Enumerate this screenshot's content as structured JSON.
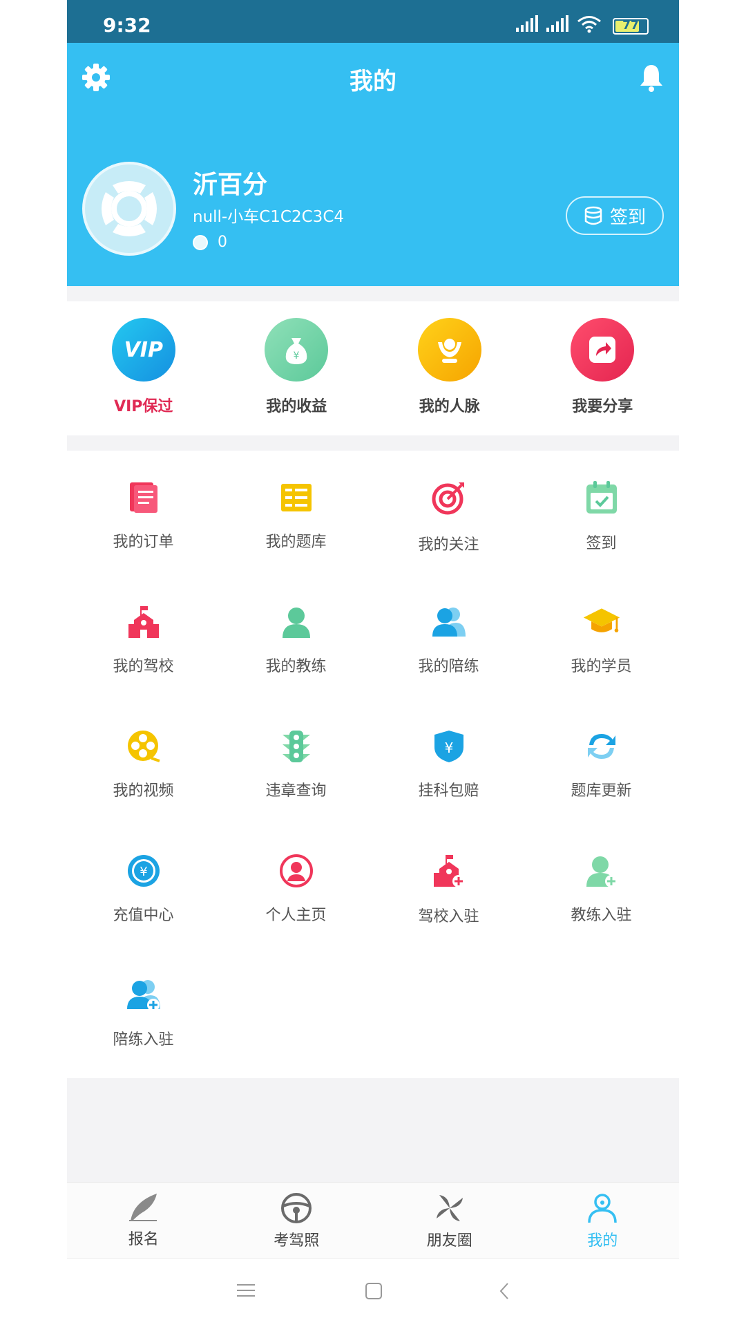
{
  "status_bar": {
    "time": "9:32",
    "battery": "77"
  },
  "header": {
    "title": "我的"
  },
  "profile": {
    "name": "沂百分",
    "subtitle": "null-小车C1C2C3C4",
    "coins": "0",
    "checkin_label": "签到"
  },
  "quick_actions": [
    {
      "label": "VIP保过",
      "icon": "vip-icon",
      "color": "#1aa7e8"
    },
    {
      "label": "我的收益",
      "icon": "money-bag-icon",
      "color": "#7fd8a7"
    },
    {
      "label": "我的人脉",
      "icon": "people-hands-icon",
      "color": "#f5b400"
    },
    {
      "label": "我要分享",
      "icon": "share-icon",
      "color": "#f0365a"
    }
  ],
  "grid": [
    {
      "label": "我的订单",
      "icon": "order-icon"
    },
    {
      "label": "我的题库",
      "icon": "question-bank-icon"
    },
    {
      "label": "我的关注",
      "icon": "target-icon"
    },
    {
      "label": "签到",
      "icon": "calendar-check-icon"
    },
    {
      "label": "我的驾校",
      "icon": "school-icon"
    },
    {
      "label": "我的教练",
      "icon": "coach-icon"
    },
    {
      "label": "我的陪练",
      "icon": "partner-icon"
    },
    {
      "label": "我的学员",
      "icon": "graduation-cap-icon"
    },
    {
      "label": "我的视频",
      "icon": "film-reel-icon"
    },
    {
      "label": "违章查询",
      "icon": "traffic-light-icon"
    },
    {
      "label": "挂科包赔",
      "icon": "shield-compensation-icon"
    },
    {
      "label": "题库更新",
      "icon": "refresh-icon"
    },
    {
      "label": "充值中心",
      "icon": "yen-coin-icon"
    },
    {
      "label": "个人主页",
      "icon": "profile-icon"
    },
    {
      "label": "驾校入驻",
      "icon": "school-add-icon"
    },
    {
      "label": "教练入驻",
      "icon": "coach-add-icon"
    },
    {
      "label": "陪练入驻",
      "icon": "partner-add-icon"
    }
  ],
  "tabs": [
    {
      "label": "报名",
      "icon": "quill-icon"
    },
    {
      "label": "考驾照",
      "icon": "steering-wheel-icon"
    },
    {
      "label": "朋友圈",
      "icon": "pinwheel-icon"
    },
    {
      "label": "我的",
      "icon": "user-icon",
      "active": true
    }
  ],
  "colors": {
    "primary": "#35bff2",
    "status_bar": "#1d6f93",
    "accent_red": "#e02a54"
  }
}
